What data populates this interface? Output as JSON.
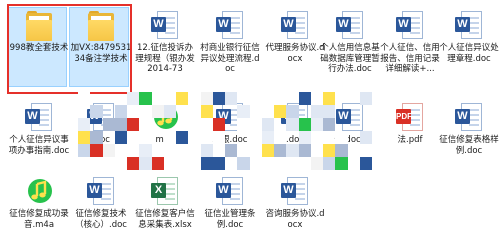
{
  "desktop_items": [
    {
      "id": "f1",
      "type": "folder",
      "label": "998教全套技术",
      "selected": true
    },
    {
      "id": "f2",
      "type": "folder",
      "label": "加VX:847953134备注学技术",
      "selected": true
    },
    {
      "id": "d3",
      "type": "docx",
      "label": "12.征信投诉办理规程（银办发2014-73",
      "selected": false
    },
    {
      "id": "d4",
      "type": "docx",
      "label": "村商业银行征信异议处理流程.doc",
      "selected": false
    },
    {
      "id": "d5",
      "type": "docx",
      "label": "代理服务协议.docx",
      "selected": false
    },
    {
      "id": "d6",
      "type": "docx",
      "label": "个人信用信息基础数据库管理暂行办法.doc",
      "selected": false
    },
    {
      "id": "d7",
      "type": "docx",
      "label": "个人征信、信用报告、信用记录详细解读+...",
      "selected": false
    },
    {
      "id": "d8",
      "type": "docx",
      "label": "个人征信异议处理章程.doc",
      "selected": false
    },
    {
      "id": "d9",
      "type": "docx",
      "label": "个人征信异议事项办事指南.doc",
      "selected": false
    },
    {
      "id": "d10",
      "type": "docx",
      "label": ".doc",
      "selected": false
    },
    {
      "id": "m11",
      "type": "m4a",
      "label": "m4a",
      "selected": false
    },
    {
      "id": "d12",
      "type": "docx",
      "label": "发银.doc",
      "selected": false
    },
    {
      "id": "d13",
      "type": "docx",
      "label": ".doc",
      "selected": false
    },
    {
      "id": "d14",
      "type": "docx",
      "label": "告.docx",
      "selected": false
    },
    {
      "id": "p15",
      "type": "pdf",
      "label": "法.pdf",
      "selected": false
    },
    {
      "id": "d16",
      "type": "docx",
      "label": "征信修复表格样例.doc",
      "selected": false
    },
    {
      "id": "m17",
      "type": "m4a",
      "label": "征信修复成功录音.m4a",
      "selected": false
    },
    {
      "id": "d18",
      "type": "docx",
      "label": "征信修复技术（核心）.doc",
      "selected": false
    },
    {
      "id": "x19",
      "type": "xlsx",
      "label": "征信修复客户信息采集表.xlsx",
      "selected": false
    },
    {
      "id": "d20",
      "type": "docx",
      "label": "征信业管理条例.doc",
      "selected": false
    },
    {
      "id": "d21",
      "type": "docx",
      "label": "咨询服务协议.docx",
      "selected": false
    }
  ],
  "icons": {
    "folder": "folder-icon",
    "docx": "word-document-icon",
    "xlsx": "excel-spreadsheet-icon",
    "pdf": "pdf-document-icon",
    "m4a": "music-audio-icon"
  },
  "colors": {
    "selection_outline": "#e5302a",
    "selection_fill": "#cce8ff",
    "word_blue": "#2b579a",
    "excel_green": "#217346",
    "folder_yellow": "#f6c646",
    "audio_green": "#27c24c"
  }
}
